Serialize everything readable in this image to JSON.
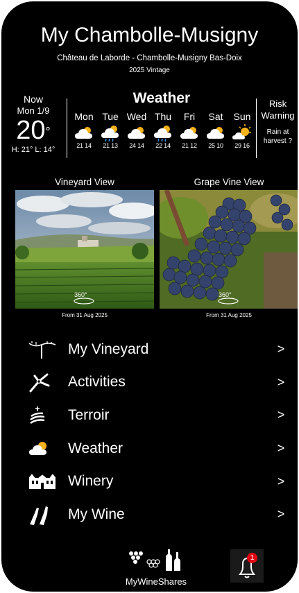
{
  "header": {
    "title": "My Chambolle-Musigny",
    "subtitle": "Château de Laborde - Chambolle-Musigny Bas-Doix",
    "vintage": "2025 Vintage"
  },
  "now": {
    "label": "Now",
    "date": "Mon 1/9",
    "temp": "20",
    "deg": "°",
    "high_low": "H: 21°  L: 14°"
  },
  "weather": {
    "title": "Weather",
    "days": [
      {
        "name": "Mon",
        "icon": "cloud-sun-icon",
        "high": "21",
        "low": "14"
      },
      {
        "name": "Tue",
        "icon": "cloud-rain-icon",
        "high": "21",
        "low": "13"
      },
      {
        "name": "Wed",
        "icon": "cloud-sun-icon",
        "high": "24",
        "low": "14"
      },
      {
        "name": "Thu",
        "icon": "cloud-rain-icon",
        "high": "22",
        "low": "14"
      },
      {
        "name": "Fri",
        "icon": "cloud-sun-icon",
        "high": "21",
        "low": "12"
      },
      {
        "name": "Sat",
        "icon": "cloud-sun-icon",
        "high": "25",
        "low": "10"
      },
      {
        "name": "Sun",
        "icon": "sun-cloud-icon",
        "high": "29",
        "low": "16"
      }
    ]
  },
  "risk": {
    "title1": "Risk",
    "title2": "Warning",
    "text1": "Rain at",
    "text2": "harvest ?"
  },
  "views": {
    "vineyard": {
      "label": "Vineyard View",
      "badge": "360°",
      "date": "From 31 Aug 2025"
    },
    "grape": {
      "label": "Grape Vine View",
      "badge": "360°",
      "date": "From 31 Aug 2025"
    }
  },
  "menu": [
    {
      "label": "My Vineyard",
      "icon": "vine-icon",
      "arrow": ">"
    },
    {
      "label": "Activities",
      "icon": "pruning-shears-icon",
      "arrow": ">"
    },
    {
      "label": "Terroir",
      "icon": "terroir-icon",
      "arrow": ">"
    },
    {
      "label": "Weather",
      "icon": "cloud-sun-icon",
      "arrow": ">"
    },
    {
      "label": "Winery",
      "icon": "chateau-icon",
      "arrow": ">"
    },
    {
      "label": "My Wine",
      "icon": "wine-bottles-icon",
      "arrow": ">"
    }
  ],
  "footer": {
    "brand": "MyWineShares",
    "notification_count": "1"
  },
  "colors": {
    "background": "#000000",
    "text": "#ffffff",
    "sun": "#f6b21a",
    "rain": "#3a8fd9",
    "badge": "#e10613"
  }
}
